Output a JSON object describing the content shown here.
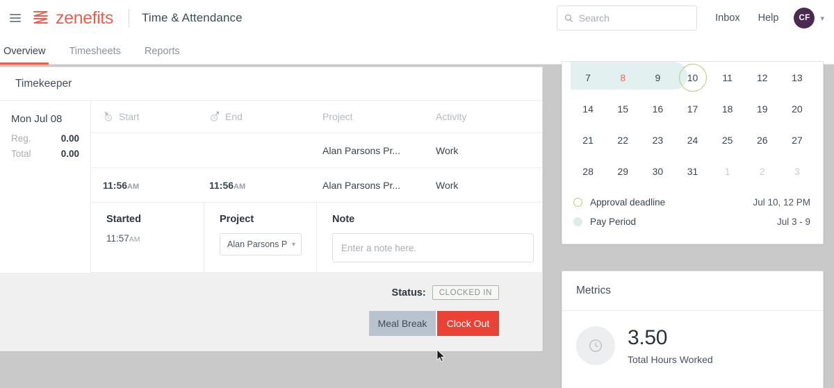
{
  "topbar": {
    "menu_icon": "hamburger-icon",
    "brand": "zenefits",
    "app_title": "Time & Attendance",
    "search": {
      "placeholder": "Search",
      "value": "",
      "icon": "search-icon"
    },
    "inbox_label": "Inbox",
    "help_label": "Help",
    "avatar_initials": "CF",
    "avatar_color": "#4b2a52",
    "caret_icon": "chevron-down-icon"
  },
  "tabs": [
    {
      "label": "Overview",
      "active": true
    },
    {
      "label": "Timesheets",
      "active": false
    },
    {
      "label": "Reports",
      "active": false
    }
  ],
  "timekeeper": {
    "title": "Timekeeper",
    "day": {
      "date": "Mon Jul 08",
      "rows": [
        {
          "label": "Reg.",
          "value": "0.00"
        },
        {
          "label": "Total",
          "value": "0.00"
        }
      ]
    },
    "columns": {
      "start": "Start",
      "end": "End",
      "project": "Project",
      "activity": "Activity"
    },
    "entries": [
      {
        "start": "",
        "start_ampm": "",
        "end": "",
        "end_ampm": "",
        "project": "Alan Parsons Pr...",
        "activity": "Work"
      },
      {
        "start": "11:56",
        "start_ampm": "AM",
        "end": "11:56",
        "end_ampm": "AM",
        "project": "Alan Parsons Pr...",
        "activity": "Work"
      }
    ],
    "current": {
      "started_label": "Started",
      "started_time": "11:57",
      "started_ampm": "AM",
      "project_label": "Project",
      "project_value": "Alan Parsons P",
      "note_label": "Note",
      "note_placeholder": "Enter a note here.",
      "note_value": ""
    },
    "footer": {
      "status_label": "Status:",
      "status_value": "CLOCKED IN",
      "meal_break_label": "Meal Break",
      "clock_out_label": "Clock Out",
      "clock_out_color": "#ea4335",
      "meal_break_color": "#b9c2cf"
    }
  },
  "calendar": {
    "weeks": [
      [
        {
          "d": "7",
          "state": "payperiod"
        },
        {
          "d": "8",
          "state": "payperiod-today"
        },
        {
          "d": "9",
          "state": "payperiod"
        },
        {
          "d": "10",
          "state": "deadline"
        },
        {
          "d": "11",
          "state": "normal"
        },
        {
          "d": "12",
          "state": "normal"
        },
        {
          "d": "13",
          "state": "normal"
        }
      ],
      [
        {
          "d": "14",
          "state": "normal"
        },
        {
          "d": "15",
          "state": "normal"
        },
        {
          "d": "16",
          "state": "normal"
        },
        {
          "d": "17",
          "state": "normal"
        },
        {
          "d": "18",
          "state": "normal"
        },
        {
          "d": "19",
          "state": "normal"
        },
        {
          "d": "20",
          "state": "normal"
        }
      ],
      [
        {
          "d": "21",
          "state": "normal"
        },
        {
          "d": "22",
          "state": "normal"
        },
        {
          "d": "23",
          "state": "normal"
        },
        {
          "d": "24",
          "state": "normal"
        },
        {
          "d": "25",
          "state": "normal"
        },
        {
          "d": "26",
          "state": "normal"
        },
        {
          "d": "27",
          "state": "normal"
        }
      ],
      [
        {
          "d": "28",
          "state": "normal"
        },
        {
          "d": "29",
          "state": "normal"
        },
        {
          "d": "30",
          "state": "normal"
        },
        {
          "d": "31",
          "state": "normal"
        },
        {
          "d": "1",
          "state": "muted"
        },
        {
          "d": "2",
          "state": "muted"
        },
        {
          "d": "3",
          "state": "muted"
        }
      ]
    ],
    "legend": [
      {
        "label": "Approval deadline",
        "value": "Jul 10, 12 PM",
        "marker": "ring",
        "color": "#b5cc7a"
      },
      {
        "label": "Pay Period",
        "value": "Jul 3 - 9",
        "marker": "fill",
        "color": "#d9eeec"
      }
    ]
  },
  "metrics": {
    "title": "Metrics",
    "icon": "clock-icon",
    "value": "3.50",
    "caption": "Total Hours Worked"
  }
}
